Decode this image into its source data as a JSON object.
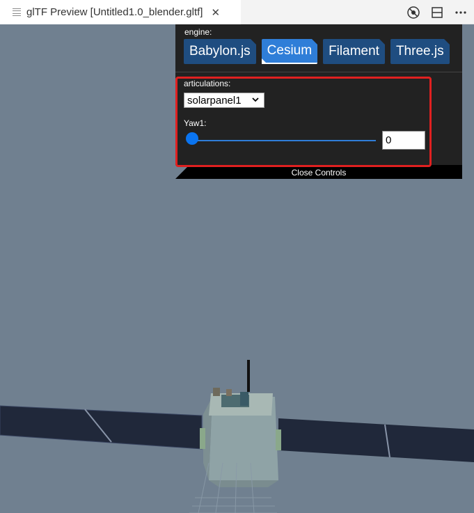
{
  "tab": {
    "title": "glTF Preview [Untitled1.0_blender.gltf]",
    "close_symbol": "✕"
  },
  "actions": [
    {
      "name": "debug-icon"
    },
    {
      "name": "split-editor-icon"
    },
    {
      "name": "more-icon"
    }
  ],
  "controls": {
    "engine_label": "engine:",
    "engines": [
      "Babylon.js",
      "Cesium",
      "Filament",
      "Three.js"
    ],
    "selected_engine": "Cesium",
    "articulations_label": "articulations:",
    "articulation_selected": "solarpanel1",
    "yaw_label": "Yaw1:",
    "yaw_value": "0",
    "close_label": "Close Controls"
  },
  "colors": {
    "viewport_bg": "#708090",
    "panel_bg": "#222222",
    "engine_btn": "#1f4d80",
    "engine_btn_selected": "#2f7ed8",
    "highlight": "#e02020"
  }
}
